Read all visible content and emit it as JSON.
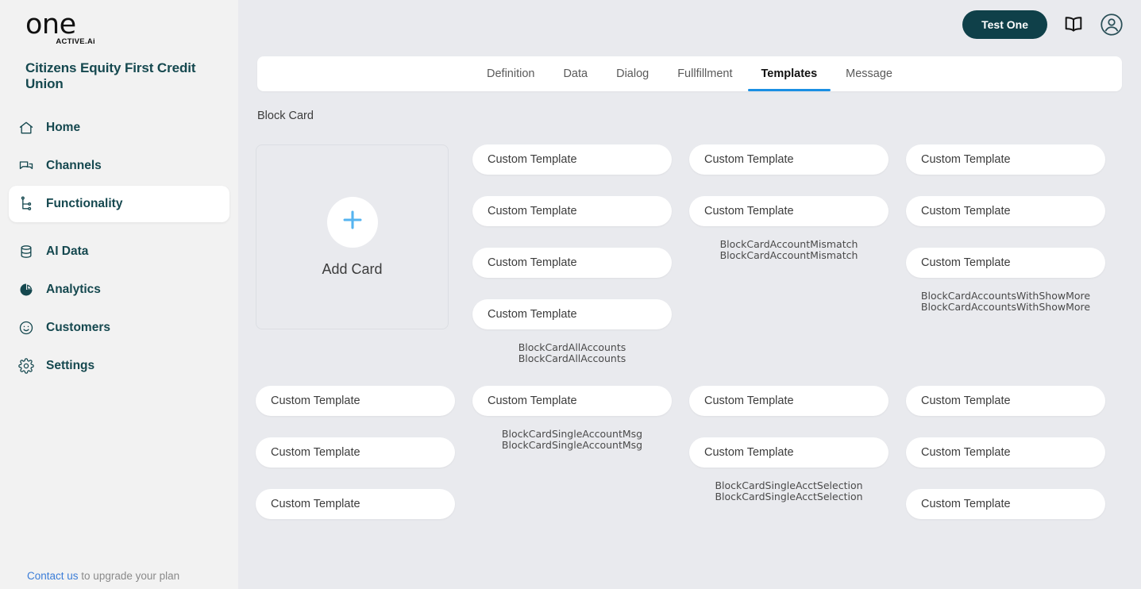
{
  "brand": {
    "logo_text": "one",
    "logo_sub": "ACTIVE.Ai",
    "org_name": "Citizens Equity First Credit Union",
    "accent_teal": "#0f4049",
    "accent_blue": "#1a8fe3",
    "link_blue": "#3b7dd8"
  },
  "sidebar": {
    "items": [
      {
        "label": "Home",
        "icon": "home-icon",
        "active": false
      },
      {
        "label": "Channels",
        "icon": "chat-bubbles-icon",
        "active": false
      },
      {
        "label": "Functionality",
        "icon": "node-tree-icon",
        "active": true
      },
      {
        "label": "AI Data",
        "icon": "database-icon",
        "active": false
      },
      {
        "label": "Analytics",
        "icon": "pie-chart-icon",
        "active": false
      },
      {
        "label": "Customers",
        "icon": "smiley-face-icon",
        "active": false
      },
      {
        "label": "Settings",
        "icon": "gear-icon",
        "active": false
      }
    ],
    "footer": {
      "link_text": "Contact us",
      "rest_text": " to upgrade your plan"
    }
  },
  "header": {
    "test_button": "Test One",
    "book_icon": "book-icon",
    "account_icon": "user-account-icon"
  },
  "tabs": [
    {
      "label": "Definition",
      "active": false
    },
    {
      "label": "Data",
      "active": false
    },
    {
      "label": "Dialog",
      "active": false
    },
    {
      "label": "Fullfillment",
      "active": false
    },
    {
      "label": "Templates",
      "active": true
    },
    {
      "label": "Message",
      "active": false
    }
  ],
  "page": {
    "title": "Block Card",
    "add_card": {
      "label": "Add Card",
      "plus_icon": "plus-icon"
    },
    "template_label": "Custom Template",
    "groups": [
      {
        "cards": [],
        "captions": [],
        "is_add_card": true
      },
      {
        "cards": [
          "Custom Template",
          "Custom Template",
          "Custom Template",
          "Custom Template"
        ],
        "captions": [
          "BlockCardAllAccounts",
          "BlockCardAllAccounts"
        ],
        "is_add_card": false
      },
      {
        "cards": [
          "Custom Template",
          "Custom Template"
        ],
        "captions": [
          "BlockCardAccountMismatch",
          "BlockCardAccountMismatch"
        ],
        "is_add_card": false
      },
      {
        "cards": [
          "Custom Template",
          "Custom Template",
          "Custom Template"
        ],
        "captions": [
          "BlockCardAccountsWithShowMore",
          "BlockCardAccountsWithShowMore"
        ],
        "is_add_card": false
      },
      {
        "cards": [
          "Custom Template",
          "Custom Template",
          "Custom Template"
        ],
        "captions": [],
        "is_add_card": false
      },
      {
        "cards": [
          "Custom Template"
        ],
        "captions": [
          "BlockCardSingleAccountMsg",
          "BlockCardSingleAccountMsg"
        ],
        "is_add_card": false
      },
      {
        "cards": [
          "Custom Template",
          "Custom Template"
        ],
        "captions": [
          "BlockCardSingleAcctSelection",
          "BlockCardSingleAcctSelection"
        ],
        "is_add_card": false
      },
      {
        "cards": [
          "Custom Template",
          "Custom Template",
          "Custom Template"
        ],
        "captions": [],
        "is_add_card": false
      }
    ]
  }
}
